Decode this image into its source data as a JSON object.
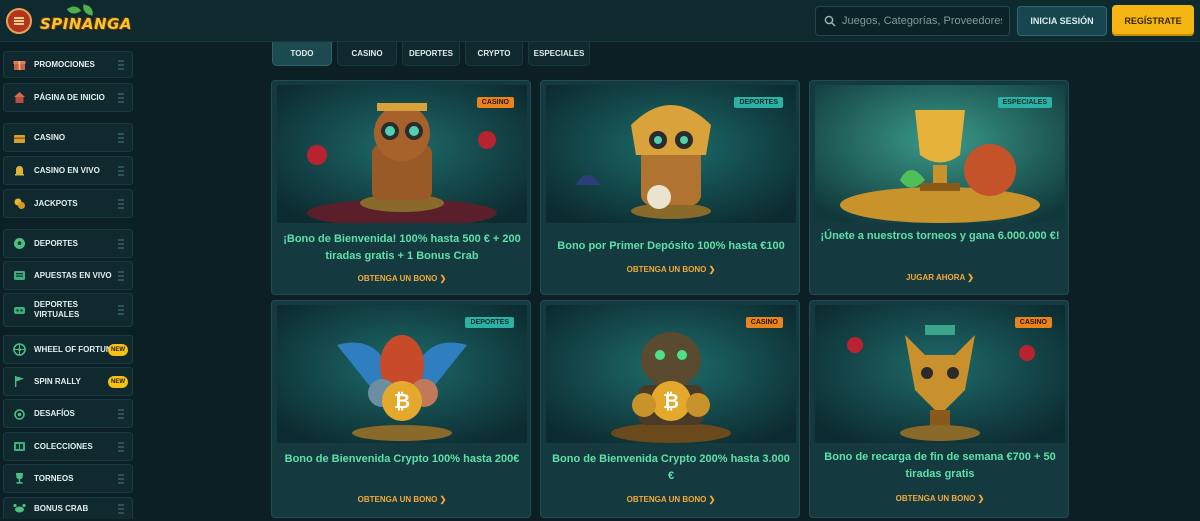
{
  "header": {
    "logo_text": "SPINANGA",
    "search_placeholder": "Juegos, Categorías, Proveedores",
    "login_label": "INICIA SESIÓN",
    "register_label": "REGÍSTRATE"
  },
  "sidebar": {
    "items": [
      {
        "label": "PROMOCIONES",
        "icon": "gift-icon"
      },
      {
        "label": "PÁGINA DE INICIO",
        "icon": "home-icon"
      },
      {
        "label": "CASINO",
        "icon": "chest-icon"
      },
      {
        "label": "CASINO EN VIVO",
        "icon": "bell-icon"
      },
      {
        "label": "JACKPOTS",
        "icon": "coins-icon"
      },
      {
        "label": "DEPORTES",
        "icon": "ball-icon"
      },
      {
        "label": "APUESTAS EN VIVO",
        "icon": "live-icon"
      },
      {
        "label": "DEPORTES VIRTUALES",
        "icon": "virtual-sports-icon"
      },
      {
        "label": "WHEEL OF FORTUNE",
        "icon": "wheel-icon",
        "badge": "NEW"
      },
      {
        "label": "SPIN RALLY",
        "icon": "flag-icon",
        "badge": "NEW"
      },
      {
        "label": "DESAFÍOS",
        "icon": "medal-icon"
      },
      {
        "label": "COLECCIONES",
        "icon": "album-icon"
      },
      {
        "label": "TORNEOS",
        "icon": "trophy-icon"
      },
      {
        "label": "BONUS CRAB",
        "icon": "crab-icon"
      }
    ]
  },
  "tabs": [
    "TODO",
    "CASINO",
    "DEPORTES",
    "CRYPTO",
    "ESPECIALES"
  ],
  "cards": [
    {
      "tag": "CASINO",
      "title": "¡Bono de Bienvenida! 100% hasta 500 € + 200 tiradas gratis + 1 Bonus Crab",
      "cta": "OBTENGA UN BONO ❯",
      "art": "monkey-idol"
    },
    {
      "tag": "DEPORTES",
      "title": "Bono por Primer Depósito 100% hasta €100",
      "cta": "OBTENGA UN BONO ❯",
      "art": "aztec-owl"
    },
    {
      "tag": "ESPECIALES",
      "title": "¡Únete a nuestros torneos y gana 6.000.000 €!",
      "cta": "JUGAR AHORA ❯",
      "art": "trophy-ball"
    },
    {
      "tag": "DEPORTES",
      "title": "Bono de Bienvenida Crypto 100% hasta 200€",
      "cta": "OBTENGA UN BONO ❯",
      "art": "eagle-bitcoin"
    },
    {
      "tag": "CASINO",
      "title": "Bono de Bienvenida Crypto 200% hasta 3.000 €",
      "cta": "OBTENGA UN BONO ❯",
      "art": "panther-bitcoin"
    },
    {
      "tag": "CASINO",
      "title": "Bono de recarga de fin de semana €700 + 50 tiradas gratis",
      "cta": "OBTENGA UN BONO ❯",
      "art": "fox-mask"
    }
  ],
  "colors": {
    "accent_green": "#5fe0a8",
    "cta_orange": "#f5a93a",
    "register_yellow": "#f5b614",
    "tag_orange": "#e9841c",
    "tag_teal": "#2bb2a5"
  }
}
